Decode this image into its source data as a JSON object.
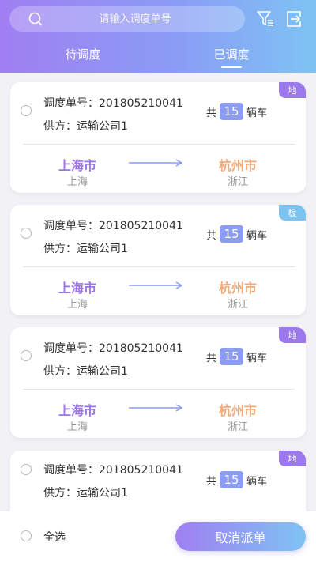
{
  "header": {
    "search_placeholder": "请输入调度单号",
    "icons": {
      "search": "search-icon",
      "filter": "filter-icon",
      "exit": "exit-icon"
    }
  },
  "tabs": [
    {
      "label": "待调度",
      "active": false
    },
    {
      "label": "已调度",
      "active": true
    }
  ],
  "colors": {
    "accent_start": "#a07ff2",
    "accent_end": "#7ec3f3",
    "badge_land": "#9b78ec",
    "badge_board": "#7cc4ef",
    "origin_city": "#9a74e8",
    "dest_city": "#f0a978"
  },
  "orders": [
    {
      "order_label": "调度单号：",
      "order_no": "201805210041",
      "supplier_label": "供方：",
      "supplier": "运输公司1",
      "badge": "地",
      "count_prefix": "共",
      "count": "15",
      "count_suffix": "辆车",
      "from_city": "上海市",
      "from_province": "上海",
      "to_city": "杭州市",
      "to_province": "浙江"
    },
    {
      "order_label": "调度单号：",
      "order_no": "201805210041",
      "supplier_label": "供方：",
      "supplier": "运输公司1",
      "badge": "板",
      "count_prefix": "共",
      "count": "15",
      "count_suffix": "辆车",
      "from_city": "上海市",
      "from_province": "上海",
      "to_city": "杭州市",
      "to_province": "浙江"
    },
    {
      "order_label": "调度单号：",
      "order_no": "201805210041",
      "supplier_label": "供方：",
      "supplier": "运输公司1",
      "badge": "地",
      "count_prefix": "共",
      "count": "15",
      "count_suffix": "辆车",
      "from_city": "上海市",
      "from_province": "上海",
      "to_city": "杭州市",
      "to_province": "浙江"
    },
    {
      "order_label": "调度单号：",
      "order_no": "201805210041",
      "supplier_label": "供方：",
      "supplier": "运输公司1",
      "badge": "地",
      "count_prefix": "共",
      "count": "15",
      "count_suffix": "辆车",
      "from_city": "",
      "from_province": "",
      "to_city": "",
      "to_province": ""
    }
  ],
  "footer": {
    "select_all_label": "全选",
    "cancel_button_label": "取消派单"
  }
}
